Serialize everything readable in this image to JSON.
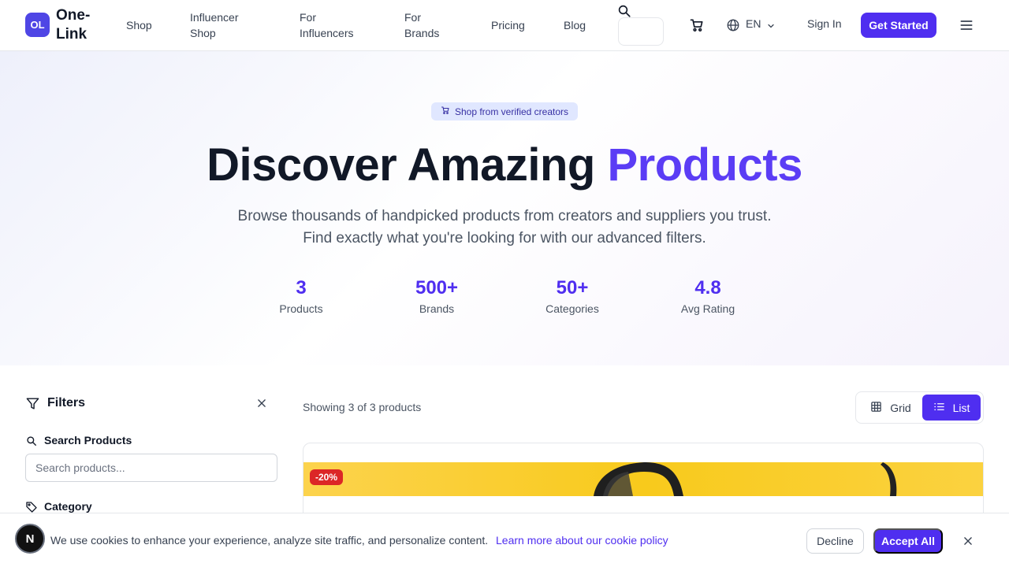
{
  "header": {
    "logo_mark": "OL",
    "logo_text": "One-Link",
    "nav": [
      {
        "label": "Shop"
      },
      {
        "label": "Influencer Shop"
      },
      {
        "label": "For Influencers"
      },
      {
        "label": "For Brands"
      },
      {
        "label": "Pricing"
      },
      {
        "label": "Blog"
      }
    ],
    "language": "EN",
    "sign_in": "Sign In",
    "get_started": "Get Started"
  },
  "hero": {
    "badge": "Shop from verified creators",
    "title_part1": "Discover Amazing",
    "title_part2": "Products",
    "subtitle": "Browse thousands of handpicked products from creators and suppliers you trust. Find exactly what you're looking for with our advanced filters.",
    "stats": [
      {
        "value": "3",
        "label": "Products"
      },
      {
        "value": "500+",
        "label": "Brands"
      },
      {
        "value": "50+",
        "label": "Categories"
      },
      {
        "value": "4.8",
        "label": "Avg Rating"
      }
    ]
  },
  "filters": {
    "title": "Filters",
    "search_label": "Search Products",
    "search_placeholder": "Search products...",
    "category_label": "Category"
  },
  "results": {
    "showing": "Showing 3 of 3 products",
    "view_grid": "Grid",
    "view_list": "List",
    "view_selected": "List"
  },
  "products": [
    {
      "discount": "-20%"
    }
  ],
  "cookie": {
    "avatar": "N",
    "text": "We use cookies to enhance your experience, analyze site traffic, and personalize content.",
    "link": "Learn more about our cookie policy",
    "decline": "Decline",
    "accept": "Accept All"
  },
  "colors": {
    "accent": "#4f2ef0",
    "discount": "#dc2626",
    "product_bg": "#f8ca1c"
  }
}
